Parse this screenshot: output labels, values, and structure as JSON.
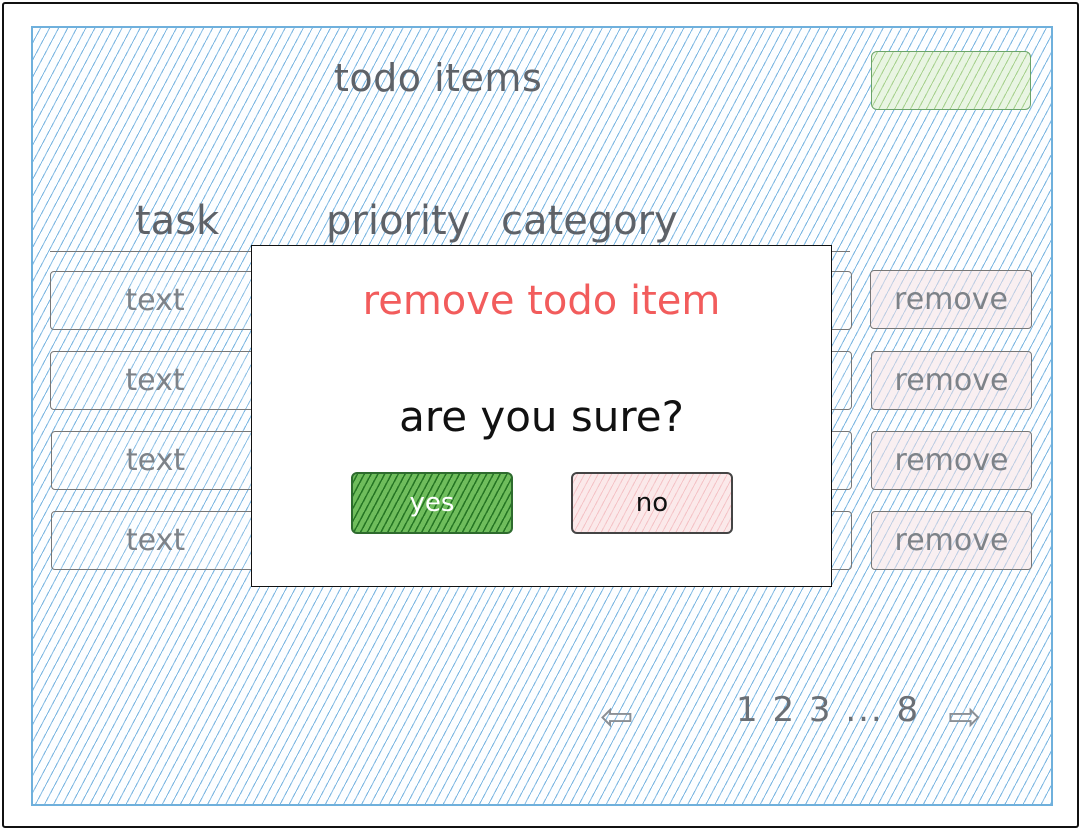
{
  "page": {
    "title": "todo items",
    "columns": {
      "task": "task",
      "priority": "priority",
      "category": "category"
    }
  },
  "rows": [
    {
      "task_text": "text",
      "remove_label": "remove"
    },
    {
      "task_text": "text",
      "remove_label": "remove"
    },
    {
      "task_text": "text",
      "remove_label": "remove"
    },
    {
      "task_text": "text",
      "remove_label": "remove"
    }
  ],
  "pagination": {
    "pages": "1 2 3 ... 8",
    "prev_icon": "left-arrow-icon",
    "next_icon": "right-arrow-icon",
    "prev_glyph": "⇦",
    "next_glyph": "⇨"
  },
  "modal": {
    "title": "remove todo item",
    "question": "are you sure?",
    "yes_label": "yes",
    "no_label": "no"
  },
  "colors": {
    "panel_hatch": "#64aadc",
    "modal_title": "#f25c5c",
    "yes_button": "#2e6b2e",
    "no_button": "#fbe9ea",
    "top_button": "#e9f5e3"
  }
}
